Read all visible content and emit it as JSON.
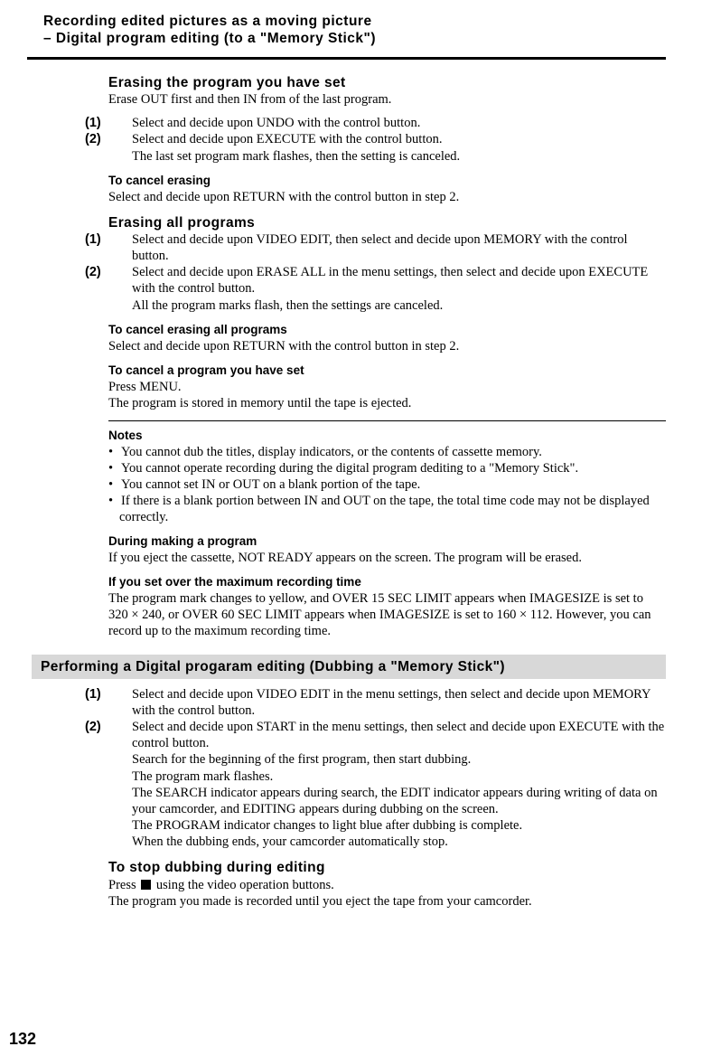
{
  "title": {
    "line1": "Recording edited pictures as a moving picture",
    "line2": "– Digital program editing (to a \"Memory Stick\")"
  },
  "s1": {
    "heading": "Erasing the program you have set",
    "intro": "Erase OUT first and then IN from of the last program.",
    "step1_num": "(1)",
    "step1": "Select and decide upon UNDO with the control button.",
    "step2_num": "(2)",
    "step2": "Select and decide upon EXECUTE with the control button.",
    "step2b": "The last set program mark flashes, then the setting is canceled."
  },
  "s2": {
    "heading": "To cancel erasing",
    "body": "Select and decide upon RETURN with the control button in step 2."
  },
  "s3": {
    "heading": "Erasing all programs",
    "step1_num": "(1)",
    "step1": "Select and decide upon VIDEO EDIT, then select and decide upon MEMORY with the control button.",
    "step2_num": "(2)",
    "step2": "Select and decide upon ERASE ALL in the menu settings, then select and decide upon EXECUTE with the control button.",
    "step2b": "All the program marks flash, then the settings are canceled."
  },
  "s4": {
    "heading": "To cancel erasing all programs",
    "body": "Select and decide upon RETURN with the control button in step 2."
  },
  "s5": {
    "heading": "To cancel a program you have set",
    "line1": "Press MENU.",
    "line2": "The program is stored in memory until the tape is ejected."
  },
  "notes": {
    "heading": "Notes",
    "n1": "You cannot dub the titles, display indicators, or the contents of cassette memory.",
    "n2": "You cannot operate recording during the digital program dediting to a \"Memory Stick\".",
    "n3": "You cannot set IN or OUT on a blank portion of the tape.",
    "n4": "If there is a blank portion between IN and OUT on the tape, the total time code may not be displayed correctly."
  },
  "s6": {
    "heading": "During making a program",
    "body": "If you eject the cassette, NOT READY appears on the screen. The program will be erased."
  },
  "s7": {
    "heading": "If you set over the maximum recording time",
    "body": "The program mark changes to yellow, and OVER 15 SEC LIMIT appears when IMAGESIZE is set to 320 × 240, or OVER 60 SEC LIMIT appears when IMAGESIZE is set to 160 × 112. However, you can record up to the maximum recording time."
  },
  "bar": "Performing a Digital progaram editing (Dubbing a \"Memory Stick\")",
  "s8": {
    "step1_num": "(1)",
    "step1": "Select and decide upon VIDEO EDIT in the menu settings, then select and decide upon MEMORY with the control button.",
    "step2_num": "(2)",
    "step2": "Select and decide upon START in the menu settings, then select and decide upon EXECUTE with the control button.",
    "l1": "Search for the beginning of the first program, then start dubbing.",
    "l2": "The program mark flashes.",
    "l3": "The SEARCH indicator appears during search, the EDIT indicator appears during writing of data on your camcorder, and EDITING appears during dubbing on the screen.",
    "l4": "The PROGRAM indicator changes to light blue after dubbing is complete.",
    "l5": "When the dubbing ends, your camcorder automatically stop."
  },
  "s9": {
    "heading": "To stop dubbing during editing",
    "line1a": "Press ",
    "line1b": " using the video operation buttons.",
    "line2": "The program you made is recorded until you eject the tape from your camcorder."
  },
  "page_number": "132"
}
